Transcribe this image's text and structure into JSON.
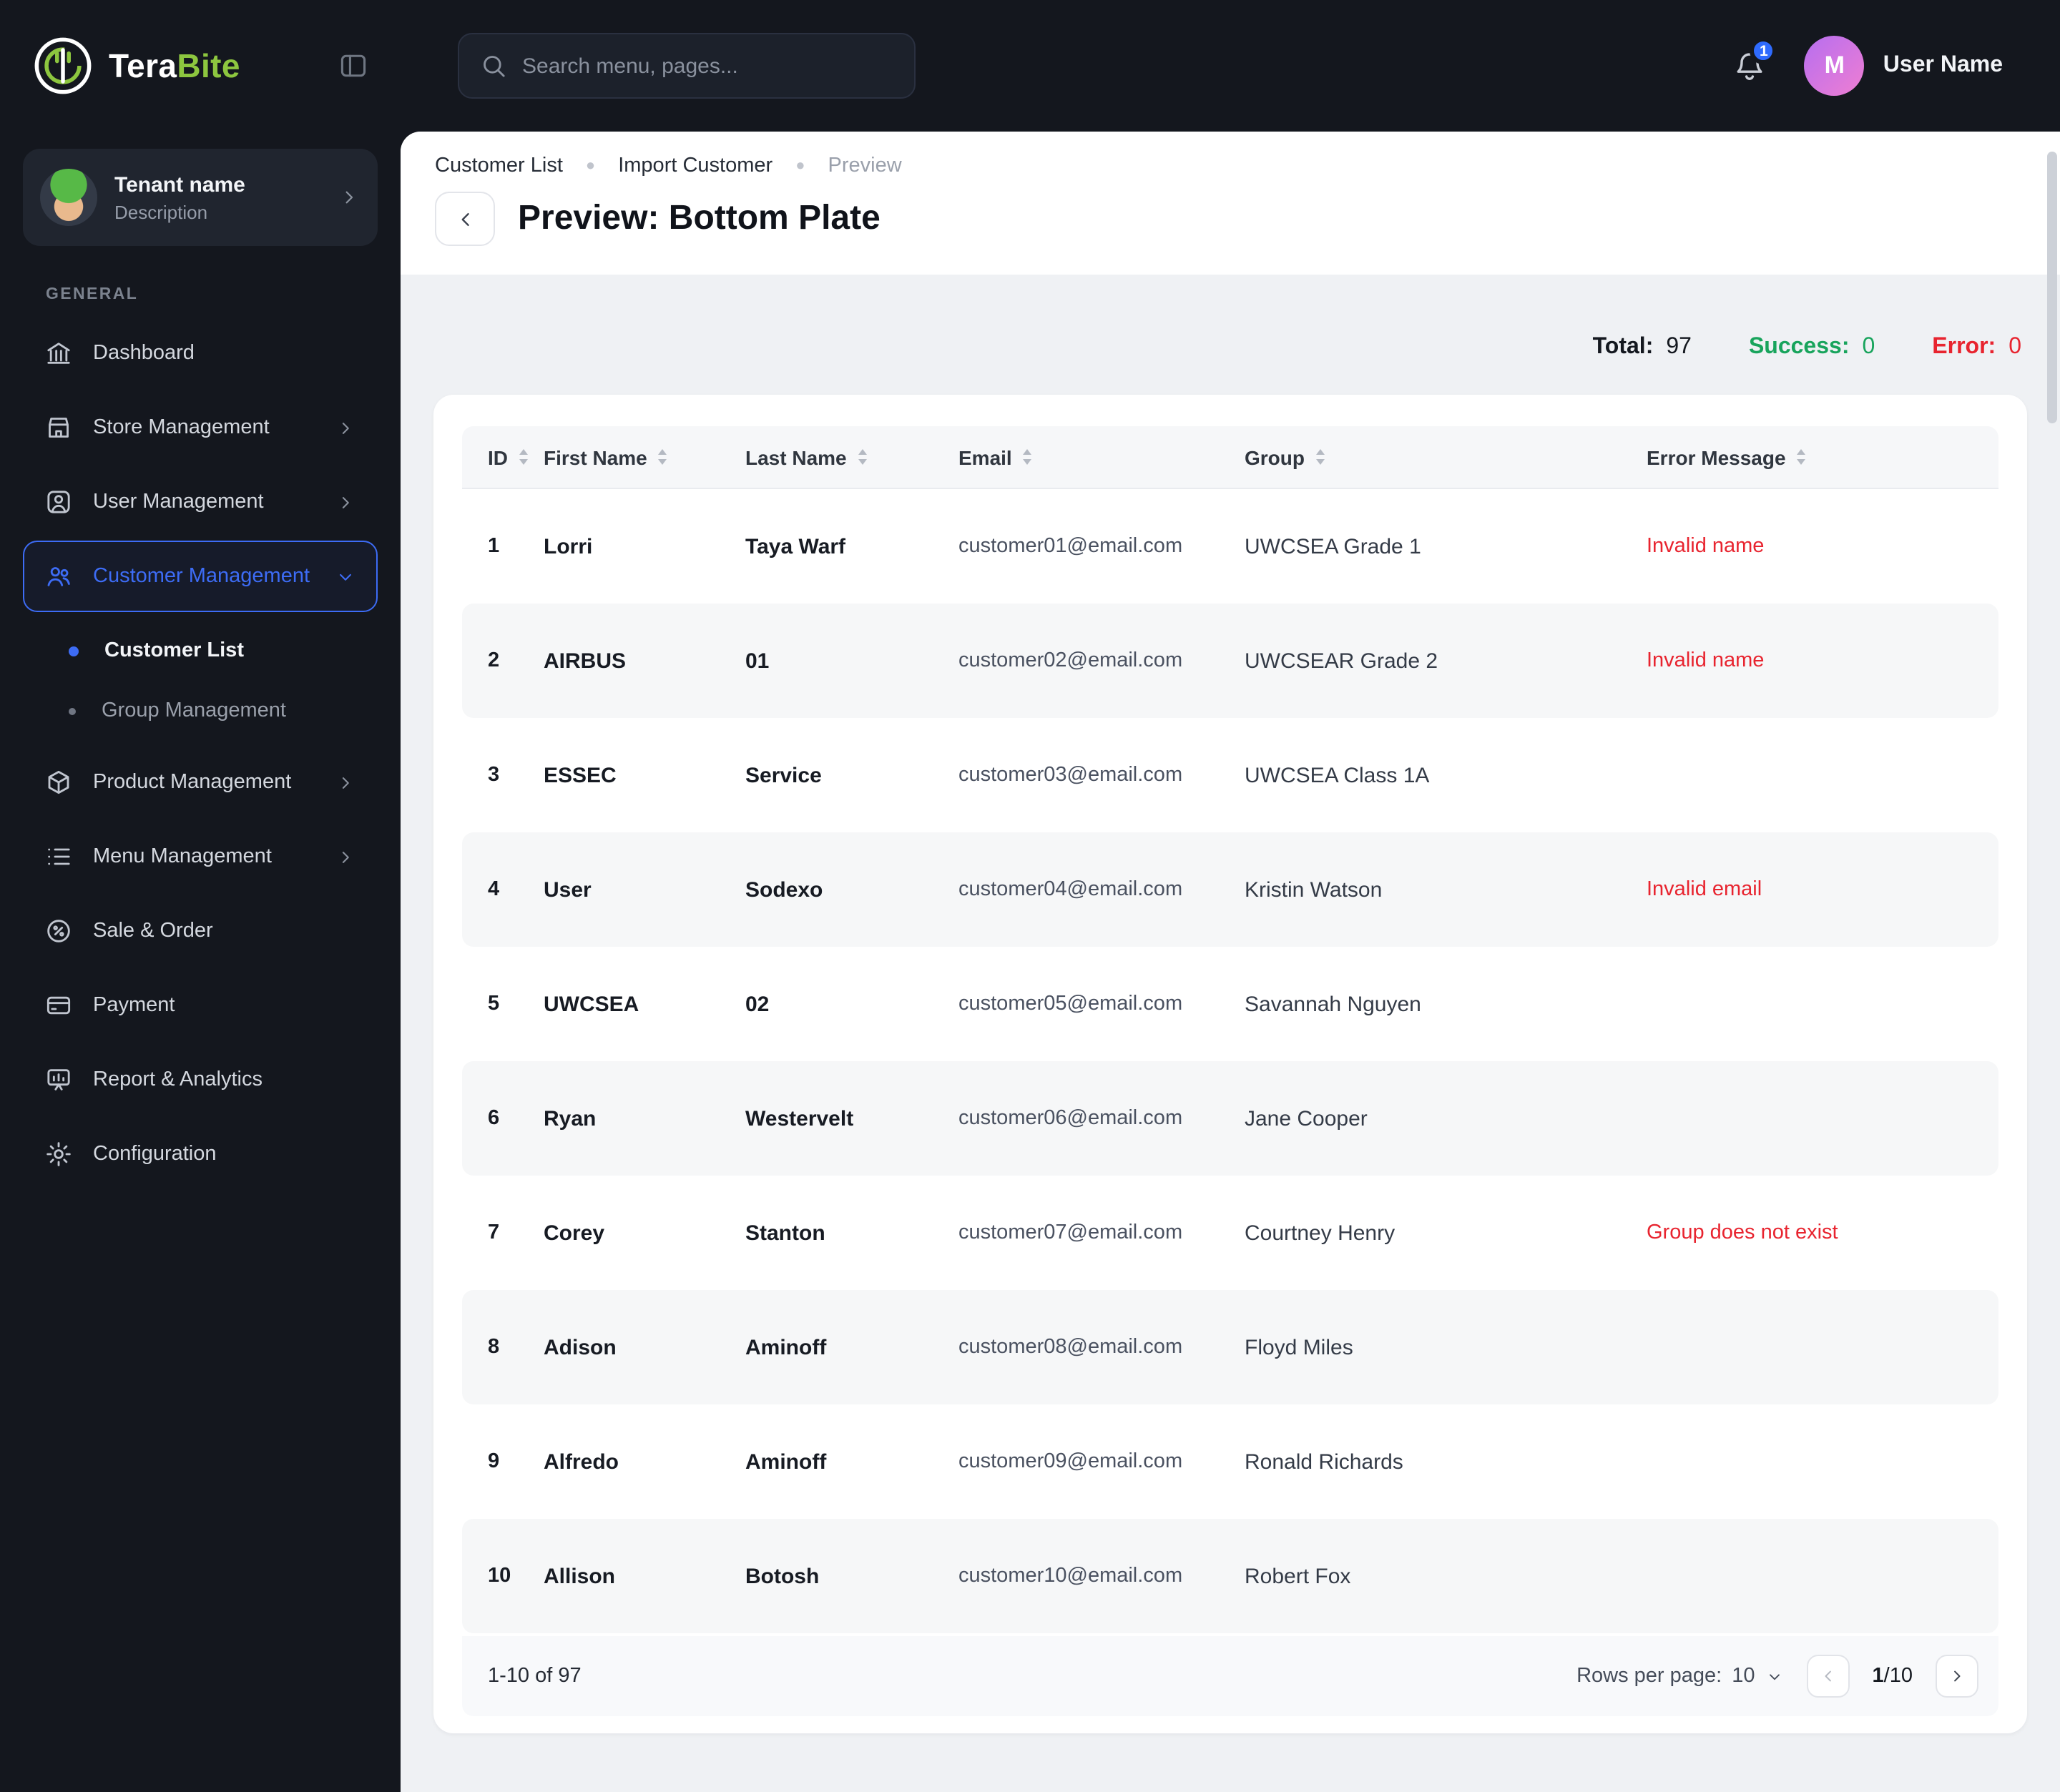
{
  "colors": {
    "accent_blue": "#3d6cf5",
    "success_green": "#18a45c",
    "error_red": "#e8242f",
    "brand_green": "#8dc63f"
  },
  "brand": {
    "name_part1": "Tera",
    "name_part2": "Bite"
  },
  "topbar": {
    "search_placeholder": "Search menu, pages...",
    "notification_count": "1",
    "user_name": "User Name",
    "avatar_initial": "M"
  },
  "sidebar": {
    "tenant": {
      "name": "Tenant name",
      "description": "Description"
    },
    "section_label": "GENERAL",
    "items": [
      {
        "label": "Dashboard",
        "icon": "dashboard-icon"
      },
      {
        "label": "Store Management",
        "icon": "store-icon",
        "expandable": true
      },
      {
        "label": "User Management",
        "icon": "user-icon",
        "expandable": true
      },
      {
        "label": "Customer Management",
        "icon": "customers-icon",
        "expandable": true,
        "active": true,
        "expanded": true
      },
      {
        "label": "Product Management",
        "icon": "product-icon",
        "expandable": true
      },
      {
        "label": "Menu Management",
        "icon": "menu-icon",
        "expandable": true
      },
      {
        "label": "Sale & Order",
        "icon": "sale-icon"
      },
      {
        "label": "Payment",
        "icon": "payment-icon"
      },
      {
        "label": "Report & Analytics",
        "icon": "report-icon"
      },
      {
        "label": "Configuration",
        "icon": "configuration-icon"
      }
    ],
    "submenu": [
      {
        "label": "Customer List",
        "active": true
      },
      {
        "label": "Group Management",
        "active": false
      }
    ]
  },
  "breadcrumb": [
    "Customer List",
    "Import Customer",
    "Preview"
  ],
  "page": {
    "title": "Preview: Bottom Plate"
  },
  "stats": {
    "total_label": "Total:",
    "total_value": "97",
    "success_label": "Success:",
    "success_value": "0",
    "error_label": "Error:",
    "error_value": "0"
  },
  "table": {
    "columns": [
      "ID",
      "First Name",
      "Last Name",
      "Email",
      "Group",
      "Error Message"
    ],
    "rows": [
      {
        "id": "1",
        "first_name": "Lorri",
        "last_name": "Taya Warf",
        "email": "customer01@email.com",
        "group": "UWCSEA Grade 1",
        "error": "Invalid name"
      },
      {
        "id": "2",
        "first_name": "AIRBUS",
        "last_name": "01",
        "email": "customer02@email.com",
        "group": "UWCSEAR Grade 2",
        "error": "Invalid name"
      },
      {
        "id": "3",
        "first_name": "ESSEC",
        "last_name": "Service",
        "email": "customer03@email.com",
        "group": "UWCSEA Class 1A",
        "error": ""
      },
      {
        "id": "4",
        "first_name": "User",
        "last_name": "Sodexo",
        "email": "customer04@email.com",
        "group": "Kristin Watson",
        "error": "Invalid email"
      },
      {
        "id": "5",
        "first_name": "UWCSEA",
        "last_name": "02",
        "email": "customer05@email.com",
        "group": "Savannah Nguyen",
        "error": ""
      },
      {
        "id": "6",
        "first_name": "Ryan",
        "last_name": "Westervelt",
        "email": "customer06@email.com",
        "group": "Jane Cooper",
        "error": ""
      },
      {
        "id": "7",
        "first_name": "Corey",
        "last_name": "Stanton",
        "email": "customer07@email.com",
        "group": "Courtney Henry",
        "error": "Group does not exist"
      },
      {
        "id": "8",
        "first_name": "Adison",
        "last_name": "Aminoff",
        "email": "customer08@email.com",
        "group": "Floyd Miles",
        "error": ""
      },
      {
        "id": "9",
        "first_name": "Alfredo",
        "last_name": "Aminoff",
        "email": "customer09@email.com",
        "group": "Ronald Richards",
        "error": ""
      },
      {
        "id": "10",
        "first_name": "Allison",
        "last_name": "Botosh",
        "email": "customer10@email.com",
        "group": "Robert Fox",
        "error": ""
      }
    ],
    "footer": {
      "range": "1-10 of 97",
      "rows_per_page_label": "Rows per page:",
      "rows_per_page_value": "10",
      "page_current": "1",
      "page_total": "/10"
    }
  }
}
